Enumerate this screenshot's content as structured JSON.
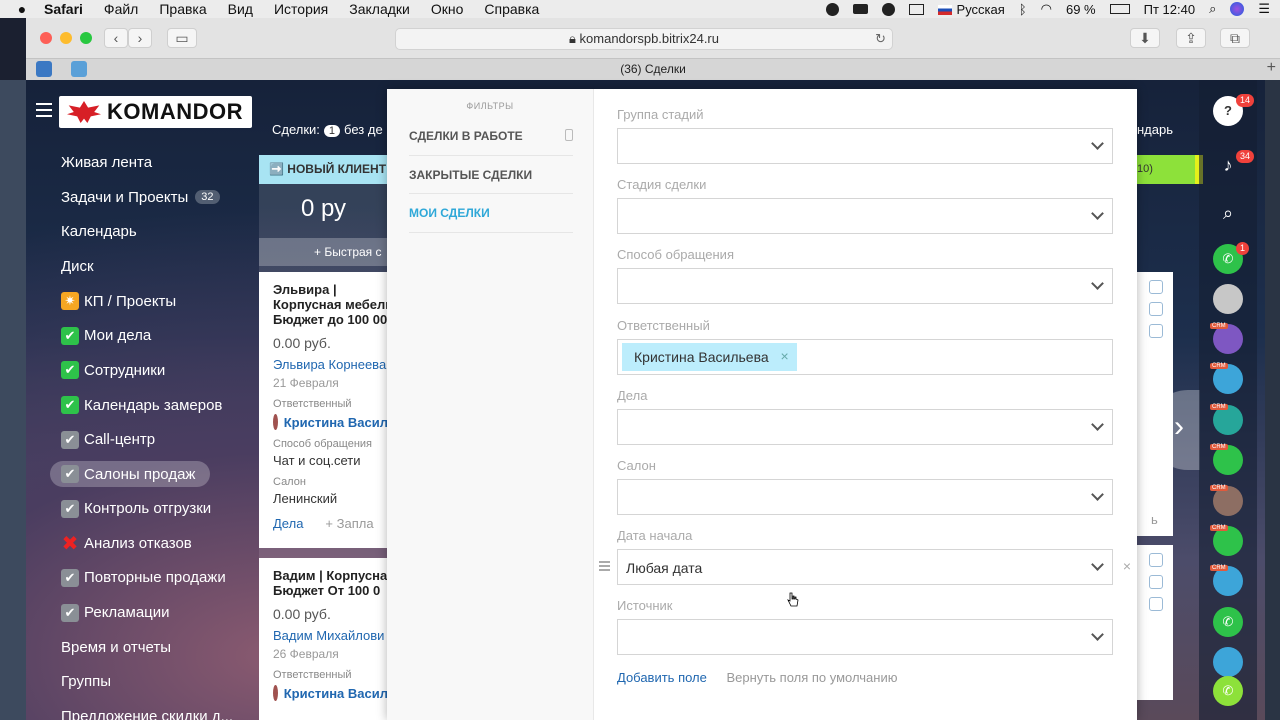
{
  "menubar": {
    "app": "Safari",
    "items": [
      "Файл",
      "Правка",
      "Вид",
      "История",
      "Закладки",
      "Окно",
      "Справка"
    ],
    "input_lang": "Русская",
    "battery": "69 %",
    "clock": "Пт 12:40"
  },
  "browser": {
    "url": "komandorspb.bitrix24.ru",
    "tab_title": "(36) Сделки"
  },
  "logo": {
    "text": "KOMANDOR"
  },
  "left_menu": [
    {
      "label": "Живая лента",
      "icon": "",
      "badge": ""
    },
    {
      "label": "Задачи и Проекты",
      "icon": "",
      "badge": "32"
    },
    {
      "label": "Календарь",
      "icon": "",
      "badge": ""
    },
    {
      "label": "Диск",
      "icon": "",
      "badge": ""
    },
    {
      "label": "КП / Проекты",
      "icon": "star-icon",
      "badge": ""
    },
    {
      "label": "Мои дела",
      "icon": "checkmark-icon",
      "badge": ""
    },
    {
      "label": "Сотрудники",
      "icon": "checkmark-icon",
      "badge": ""
    },
    {
      "label": "Календарь замеров",
      "icon": "checkmark-icon",
      "badge": ""
    },
    {
      "label": "Call-центр",
      "icon": "checkbox-grey-icon",
      "badge": ""
    },
    {
      "label": "Салоны продаж",
      "icon": "checkbox-grey-icon",
      "badge": "",
      "active": true
    },
    {
      "label": "Контроль отгрузки",
      "icon": "checkbox-grey-icon",
      "badge": ""
    },
    {
      "label": "Анализ отказов",
      "icon": "cross-icon",
      "badge": ""
    },
    {
      "label": "Повторные продажи",
      "icon": "checkbox-grey-icon",
      "badge": ""
    },
    {
      "label": "Рекламации",
      "icon": "checkbox-grey-icon",
      "badge": ""
    },
    {
      "label": "Время и отчеты",
      "icon": "",
      "badge": ""
    },
    {
      "label": "Группы",
      "icon": "",
      "badge": ""
    },
    {
      "label": "Предложение скидки д...",
      "icon": "",
      "badge": ""
    }
  ],
  "kanban": {
    "deals_label": "Сделки:",
    "deals_count": "1",
    "deals_suffix": "без де",
    "column_title": "➡️ НОВЫЙ КЛИЕНТ (",
    "column_sum": "0 ру",
    "quick_add": "+ Быстрая с",
    "right_header": "ндарь",
    "right_stage": "10)",
    "right_card_text": "ь",
    "cards": [
      {
        "title": "Эльвира | Корпусная мебель | Бюджет до 100 000",
        "price": "0.00 руб.",
        "client": "Эльвира Корнеева",
        "date": "21 Февраля",
        "resp_label": "Ответственный",
        "resp": "Кристина Васил",
        "method_label": "Способ обращения",
        "method": "Чат и соц.сети",
        "salon_label": "Салон",
        "salon": "Ленинский",
        "act1": "Дела",
        "act2": "+ Запла"
      },
      {
        "title": "Вадим | Корпусная | Бюджет От 100 0",
        "price": "0.00 руб.",
        "client": "Вадим Михайлови",
        "date": "26 Февраля",
        "resp_label": "Ответственный",
        "resp": "Кристина Васил"
      }
    ]
  },
  "filter": {
    "presets_header": "ФИЛЬТРЫ",
    "presets": [
      {
        "label": "СДЕЛКИ В РАБОТЕ",
        "pinned": true
      },
      {
        "label": "ЗАКРЫТЫЕ СДЕЛКИ"
      },
      {
        "label": "МОИ СДЕЛКИ",
        "active": true
      }
    ],
    "fields": [
      {
        "label": "Группа стадий",
        "value": "",
        "type": "select"
      },
      {
        "label": "Стадия сделки",
        "value": "",
        "type": "select"
      },
      {
        "label": "Способ обращения",
        "value": "",
        "type": "select"
      },
      {
        "label": "Ответственный",
        "value": "Кристина Васильева",
        "type": "tag"
      },
      {
        "label": "Дела",
        "value": "",
        "type": "select"
      },
      {
        "label": "Салон",
        "value": "",
        "type": "select"
      },
      {
        "label": "Дата начала",
        "value": "Любая дата",
        "type": "select",
        "hover": true
      },
      {
        "label": "Источник",
        "value": "",
        "type": "select"
      }
    ],
    "add_field": "Добавить поле",
    "reset_fields": "Вернуть поля по умолчанию"
  },
  "rail": {
    "help_badge": "14",
    "notify_badge": "34",
    "call_badge": "1",
    "crm_tag": "CRM"
  }
}
